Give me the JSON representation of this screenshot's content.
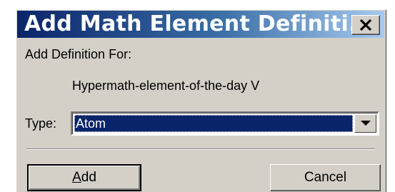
{
  "window": {
    "title": "Add Math Element Definiti..."
  },
  "form": {
    "heading": "Add Definition For:",
    "element_name": "Hypermath-element-of-the-day V",
    "type_label": "Type:",
    "type_value": "Atom"
  },
  "buttons": {
    "add_first": "A",
    "add_rest": "dd",
    "cancel": "Cancel"
  },
  "colors": {
    "title_gradient_start": "#0a246a",
    "title_gradient_end": "#a6caf0",
    "dialog_face": "#d4d0c8",
    "selection": "#0a246a"
  },
  "icons": {
    "close": "close-icon",
    "dropdown": "chevron-down-icon"
  }
}
